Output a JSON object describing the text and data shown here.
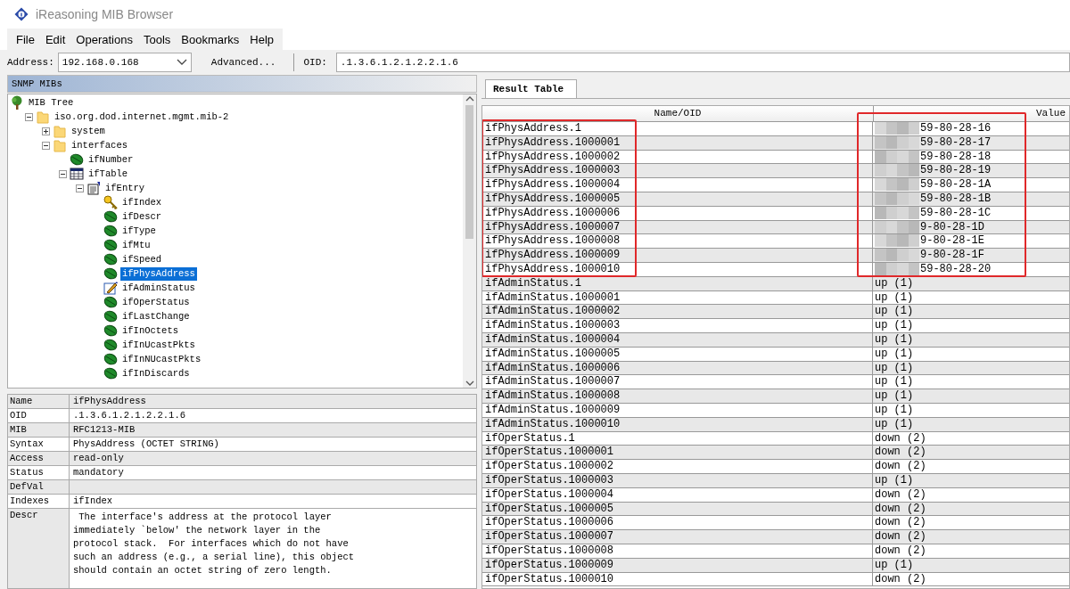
{
  "window": {
    "title": "iReasoning MIB Browser"
  },
  "menu": [
    "File",
    "Edit",
    "Operations",
    "Tools",
    "Bookmarks",
    "Help"
  ],
  "toolbar": {
    "address_label": "Address:",
    "address": "192.168.0.168",
    "advanced_button": "Advanced...",
    "oid_label": "OID:",
    "oid": ".1.3.6.1.2.1.2.2.1.6"
  },
  "mib_panel": {
    "title": "SNMP MIBs",
    "tree": [
      {
        "label": "MIB Tree",
        "kind": "root",
        "selected": false,
        "children": [
          {
            "label": "iso.org.dod.internet.mgmt.mib-2",
            "kind": "folder",
            "expanded": true,
            "selected": false,
            "children": [
              {
                "label": "system",
                "kind": "folder",
                "expanded": false,
                "selected": false
              },
              {
                "label": "interfaces",
                "kind": "folder",
                "expanded": true,
                "selected": false,
                "children": [
                  {
                    "label": "ifNumber",
                    "kind": "leaf",
                    "selected": false
                  },
                  {
                    "label": "ifTable",
                    "kind": "table",
                    "expanded": true,
                    "selected": false,
                    "children": [
                      {
                        "label": "ifEntry",
                        "kind": "entry",
                        "expanded": true,
                        "selected": false,
                        "children": [
                          {
                            "label": "ifIndex",
                            "kind": "key",
                            "selected": false
                          },
                          {
                            "label": "ifDescr",
                            "kind": "leaf",
                            "selected": false
                          },
                          {
                            "label": "ifType",
                            "kind": "leaf",
                            "selected": false
                          },
                          {
                            "label": "ifMtu",
                            "kind": "leaf",
                            "selected": false
                          },
                          {
                            "label": "ifSpeed",
                            "kind": "leaf",
                            "selected": false
                          },
                          {
                            "label": "ifPhysAddress",
                            "kind": "leaf",
                            "selected": true
                          },
                          {
                            "label": "ifAdminStatus",
                            "kind": "writable",
                            "selected": false
                          },
                          {
                            "label": "ifOperStatus",
                            "kind": "leaf",
                            "selected": false
                          },
                          {
                            "label": "ifLastChange",
                            "kind": "leaf",
                            "selected": false
                          },
                          {
                            "label": "ifInOctets",
                            "kind": "leaf",
                            "selected": false
                          },
                          {
                            "label": "ifInUcastPkts",
                            "kind": "leaf",
                            "selected": false
                          },
                          {
                            "label": "ifInNUcastPkts",
                            "kind": "leaf",
                            "selected": false
                          },
                          {
                            "label": "ifInDiscards",
                            "kind": "leaf",
                            "selected": false
                          }
                        ]
                      }
                    ]
                  }
                ]
              }
            ]
          }
        ]
      }
    ]
  },
  "properties": [
    {
      "label": "Name",
      "value": "ifPhysAddress"
    },
    {
      "label": "OID",
      "value": ".1.3.6.1.2.1.2.2.1.6"
    },
    {
      "label": "MIB",
      "value": "RFC1213-MIB"
    },
    {
      "label": "Syntax",
      "value": "PhysAddress (OCTET STRING)"
    },
    {
      "label": "Access",
      "value": "read-only"
    },
    {
      "label": "Status",
      "value": "mandatory"
    },
    {
      "label": "DefVal"
    },
    {
      "label": "Indexes",
      "value": "ifIndex"
    },
    {
      "label": "Descr",
      "value": " The interface's address at the protocol layer\nimmediately `below' the network layer in the\nprotocol stack.  For interfaces which do not have\nsuch an address (e.g., a serial line), this object\nshould contain an octet string of zero length."
    }
  ],
  "result_tab": {
    "label": "Result Table",
    "selected": true
  },
  "table": {
    "columns": [
      "Name/OID",
      "Value"
    ],
    "row_groups": [
      {
        "highlighted": true,
        "rows": [
          {
            "name": "ifPhysAddress.1",
            "value": "59-80-28-16",
            "redacted": true
          },
          {
            "name": "ifPhysAddress.1000001",
            "value": "59-80-28-17",
            "redacted": true
          },
          {
            "name": "ifPhysAddress.1000002",
            "value": "59-80-28-18",
            "redacted": true
          },
          {
            "name": "ifPhysAddress.1000003",
            "value": "59-80-28-19",
            "redacted": true
          },
          {
            "name": "ifPhysAddress.1000004",
            "value": "59-80-28-1A",
            "redacted": true
          },
          {
            "name": "ifPhysAddress.1000005",
            "value": "59-80-28-1B",
            "redacted": true
          },
          {
            "name": "ifPhysAddress.1000006",
            "value": "59-80-28-1C",
            "redacted": true
          },
          {
            "name": "ifPhysAddress.1000007",
            "value": "9-80-28-1D",
            "redacted": true
          },
          {
            "name": "ifPhysAddress.1000008",
            "value": "9-80-28-1E",
            "redacted": true
          },
          {
            "name": "ifPhysAddress.1000009",
            "value": "9-80-28-1F",
            "redacted": true
          },
          {
            "name": "ifPhysAddress.1000010",
            "value": "59-80-28-20",
            "redacted": true
          }
        ]
      },
      {
        "highlighted": false,
        "rows": [
          {
            "name": "ifAdminStatus.1",
            "value": "up (1)",
            "redacted": false
          },
          {
            "name": "ifAdminStatus.1000001",
            "value": "up (1)",
            "redacted": false
          },
          {
            "name": "ifAdminStatus.1000002",
            "value": "up (1)",
            "redacted": false
          },
          {
            "name": "ifAdminStatus.1000003",
            "value": "up (1)",
            "redacted": false
          },
          {
            "name": "ifAdminStatus.1000004",
            "value": "up (1)",
            "redacted": false
          },
          {
            "name": "ifAdminStatus.1000005",
            "value": "up (1)",
            "redacted": false
          },
          {
            "name": "ifAdminStatus.1000006",
            "value": "up (1)",
            "redacted": false
          },
          {
            "name": "ifAdminStatus.1000007",
            "value": "up (1)",
            "redacted": false
          },
          {
            "name": "ifAdminStatus.1000008",
            "value": "up (1)",
            "redacted": false
          },
          {
            "name": "ifAdminStatus.1000009",
            "value": "up (1)",
            "redacted": false
          },
          {
            "name": "ifAdminStatus.1000010",
            "value": "up (1)",
            "redacted": false
          }
        ]
      },
      {
        "highlighted": false,
        "rows": [
          {
            "name": "ifOperStatus.1",
            "value": "down (2)",
            "redacted": false
          },
          {
            "name": "ifOperStatus.1000001",
            "value": "down (2)",
            "redacted": false
          },
          {
            "name": "ifOperStatus.1000002",
            "value": "down (2)",
            "redacted": false
          },
          {
            "name": "ifOperStatus.1000003",
            "value": "up (1)",
            "redacted": false
          },
          {
            "name": "ifOperStatus.1000004",
            "value": "down (2)",
            "redacted": false
          },
          {
            "name": "ifOperStatus.1000005",
            "value": "down (2)",
            "redacted": false
          },
          {
            "name": "ifOperStatus.1000006",
            "value": "down (2)",
            "redacted": false
          },
          {
            "name": "ifOperStatus.1000007",
            "value": "down (2)",
            "redacted": false
          },
          {
            "name": "ifOperStatus.1000008",
            "value": "down (2)",
            "redacted": false
          },
          {
            "name": "ifOperStatus.1000009",
            "value": "up (1)",
            "redacted": false
          },
          {
            "name": "ifOperStatus.1000010",
            "value": "down (2)",
            "redacted": false
          }
        ]
      }
    ]
  }
}
